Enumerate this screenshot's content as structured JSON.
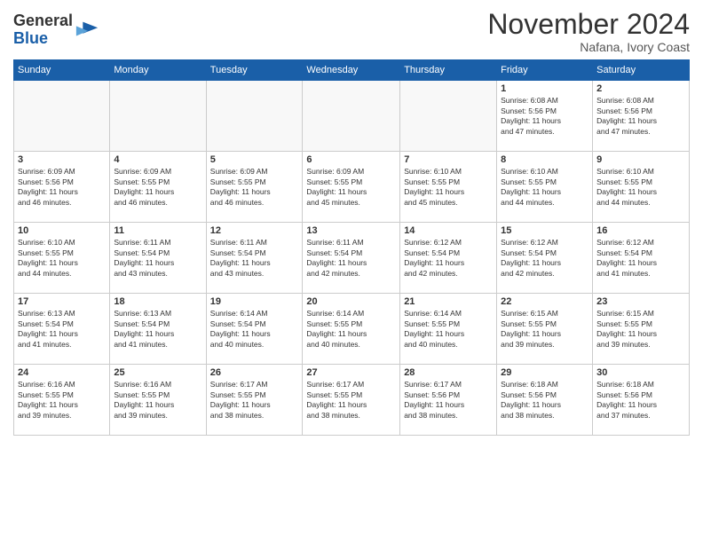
{
  "header": {
    "logo_general": "General",
    "logo_blue": "Blue",
    "month_title": "November 2024",
    "location": "Nafana, Ivory Coast"
  },
  "days_of_week": [
    "Sunday",
    "Monday",
    "Tuesday",
    "Wednesday",
    "Thursday",
    "Friday",
    "Saturday"
  ],
  "weeks": [
    {
      "days": [
        {
          "number": "",
          "empty": true
        },
        {
          "number": "",
          "empty": true
        },
        {
          "number": "",
          "empty": true
        },
        {
          "number": "",
          "empty": true
        },
        {
          "number": "",
          "empty": true
        },
        {
          "number": "1",
          "info": "Sunrise: 6:08 AM\nSunset: 5:56 PM\nDaylight: 11 hours\nand 47 minutes."
        },
        {
          "number": "2",
          "info": "Sunrise: 6:08 AM\nSunset: 5:56 PM\nDaylight: 11 hours\nand 47 minutes."
        }
      ]
    },
    {
      "days": [
        {
          "number": "3",
          "info": "Sunrise: 6:09 AM\nSunset: 5:56 PM\nDaylight: 11 hours\nand 46 minutes."
        },
        {
          "number": "4",
          "info": "Sunrise: 6:09 AM\nSunset: 5:55 PM\nDaylight: 11 hours\nand 46 minutes."
        },
        {
          "number": "5",
          "info": "Sunrise: 6:09 AM\nSunset: 5:55 PM\nDaylight: 11 hours\nand 46 minutes."
        },
        {
          "number": "6",
          "info": "Sunrise: 6:09 AM\nSunset: 5:55 PM\nDaylight: 11 hours\nand 45 minutes."
        },
        {
          "number": "7",
          "info": "Sunrise: 6:10 AM\nSunset: 5:55 PM\nDaylight: 11 hours\nand 45 minutes."
        },
        {
          "number": "8",
          "info": "Sunrise: 6:10 AM\nSunset: 5:55 PM\nDaylight: 11 hours\nand 44 minutes."
        },
        {
          "number": "9",
          "info": "Sunrise: 6:10 AM\nSunset: 5:55 PM\nDaylight: 11 hours\nand 44 minutes."
        }
      ]
    },
    {
      "days": [
        {
          "number": "10",
          "info": "Sunrise: 6:10 AM\nSunset: 5:55 PM\nDaylight: 11 hours\nand 44 minutes."
        },
        {
          "number": "11",
          "info": "Sunrise: 6:11 AM\nSunset: 5:54 PM\nDaylight: 11 hours\nand 43 minutes."
        },
        {
          "number": "12",
          "info": "Sunrise: 6:11 AM\nSunset: 5:54 PM\nDaylight: 11 hours\nand 43 minutes."
        },
        {
          "number": "13",
          "info": "Sunrise: 6:11 AM\nSunset: 5:54 PM\nDaylight: 11 hours\nand 42 minutes."
        },
        {
          "number": "14",
          "info": "Sunrise: 6:12 AM\nSunset: 5:54 PM\nDaylight: 11 hours\nand 42 minutes."
        },
        {
          "number": "15",
          "info": "Sunrise: 6:12 AM\nSunset: 5:54 PM\nDaylight: 11 hours\nand 42 minutes."
        },
        {
          "number": "16",
          "info": "Sunrise: 6:12 AM\nSunset: 5:54 PM\nDaylight: 11 hours\nand 41 minutes."
        }
      ]
    },
    {
      "days": [
        {
          "number": "17",
          "info": "Sunrise: 6:13 AM\nSunset: 5:54 PM\nDaylight: 11 hours\nand 41 minutes."
        },
        {
          "number": "18",
          "info": "Sunrise: 6:13 AM\nSunset: 5:54 PM\nDaylight: 11 hours\nand 41 minutes."
        },
        {
          "number": "19",
          "info": "Sunrise: 6:14 AM\nSunset: 5:54 PM\nDaylight: 11 hours\nand 40 minutes."
        },
        {
          "number": "20",
          "info": "Sunrise: 6:14 AM\nSunset: 5:55 PM\nDaylight: 11 hours\nand 40 minutes."
        },
        {
          "number": "21",
          "info": "Sunrise: 6:14 AM\nSunset: 5:55 PM\nDaylight: 11 hours\nand 40 minutes."
        },
        {
          "number": "22",
          "info": "Sunrise: 6:15 AM\nSunset: 5:55 PM\nDaylight: 11 hours\nand 39 minutes."
        },
        {
          "number": "23",
          "info": "Sunrise: 6:15 AM\nSunset: 5:55 PM\nDaylight: 11 hours\nand 39 minutes."
        }
      ]
    },
    {
      "days": [
        {
          "number": "24",
          "info": "Sunrise: 6:16 AM\nSunset: 5:55 PM\nDaylight: 11 hours\nand 39 minutes."
        },
        {
          "number": "25",
          "info": "Sunrise: 6:16 AM\nSunset: 5:55 PM\nDaylight: 11 hours\nand 39 minutes."
        },
        {
          "number": "26",
          "info": "Sunrise: 6:17 AM\nSunset: 5:55 PM\nDaylight: 11 hours\nand 38 minutes."
        },
        {
          "number": "27",
          "info": "Sunrise: 6:17 AM\nSunset: 5:55 PM\nDaylight: 11 hours\nand 38 minutes."
        },
        {
          "number": "28",
          "info": "Sunrise: 6:17 AM\nSunset: 5:56 PM\nDaylight: 11 hours\nand 38 minutes."
        },
        {
          "number": "29",
          "info": "Sunrise: 6:18 AM\nSunset: 5:56 PM\nDaylight: 11 hours\nand 38 minutes."
        },
        {
          "number": "30",
          "info": "Sunrise: 6:18 AM\nSunset: 5:56 PM\nDaylight: 11 hours\nand 37 minutes."
        }
      ]
    }
  ]
}
